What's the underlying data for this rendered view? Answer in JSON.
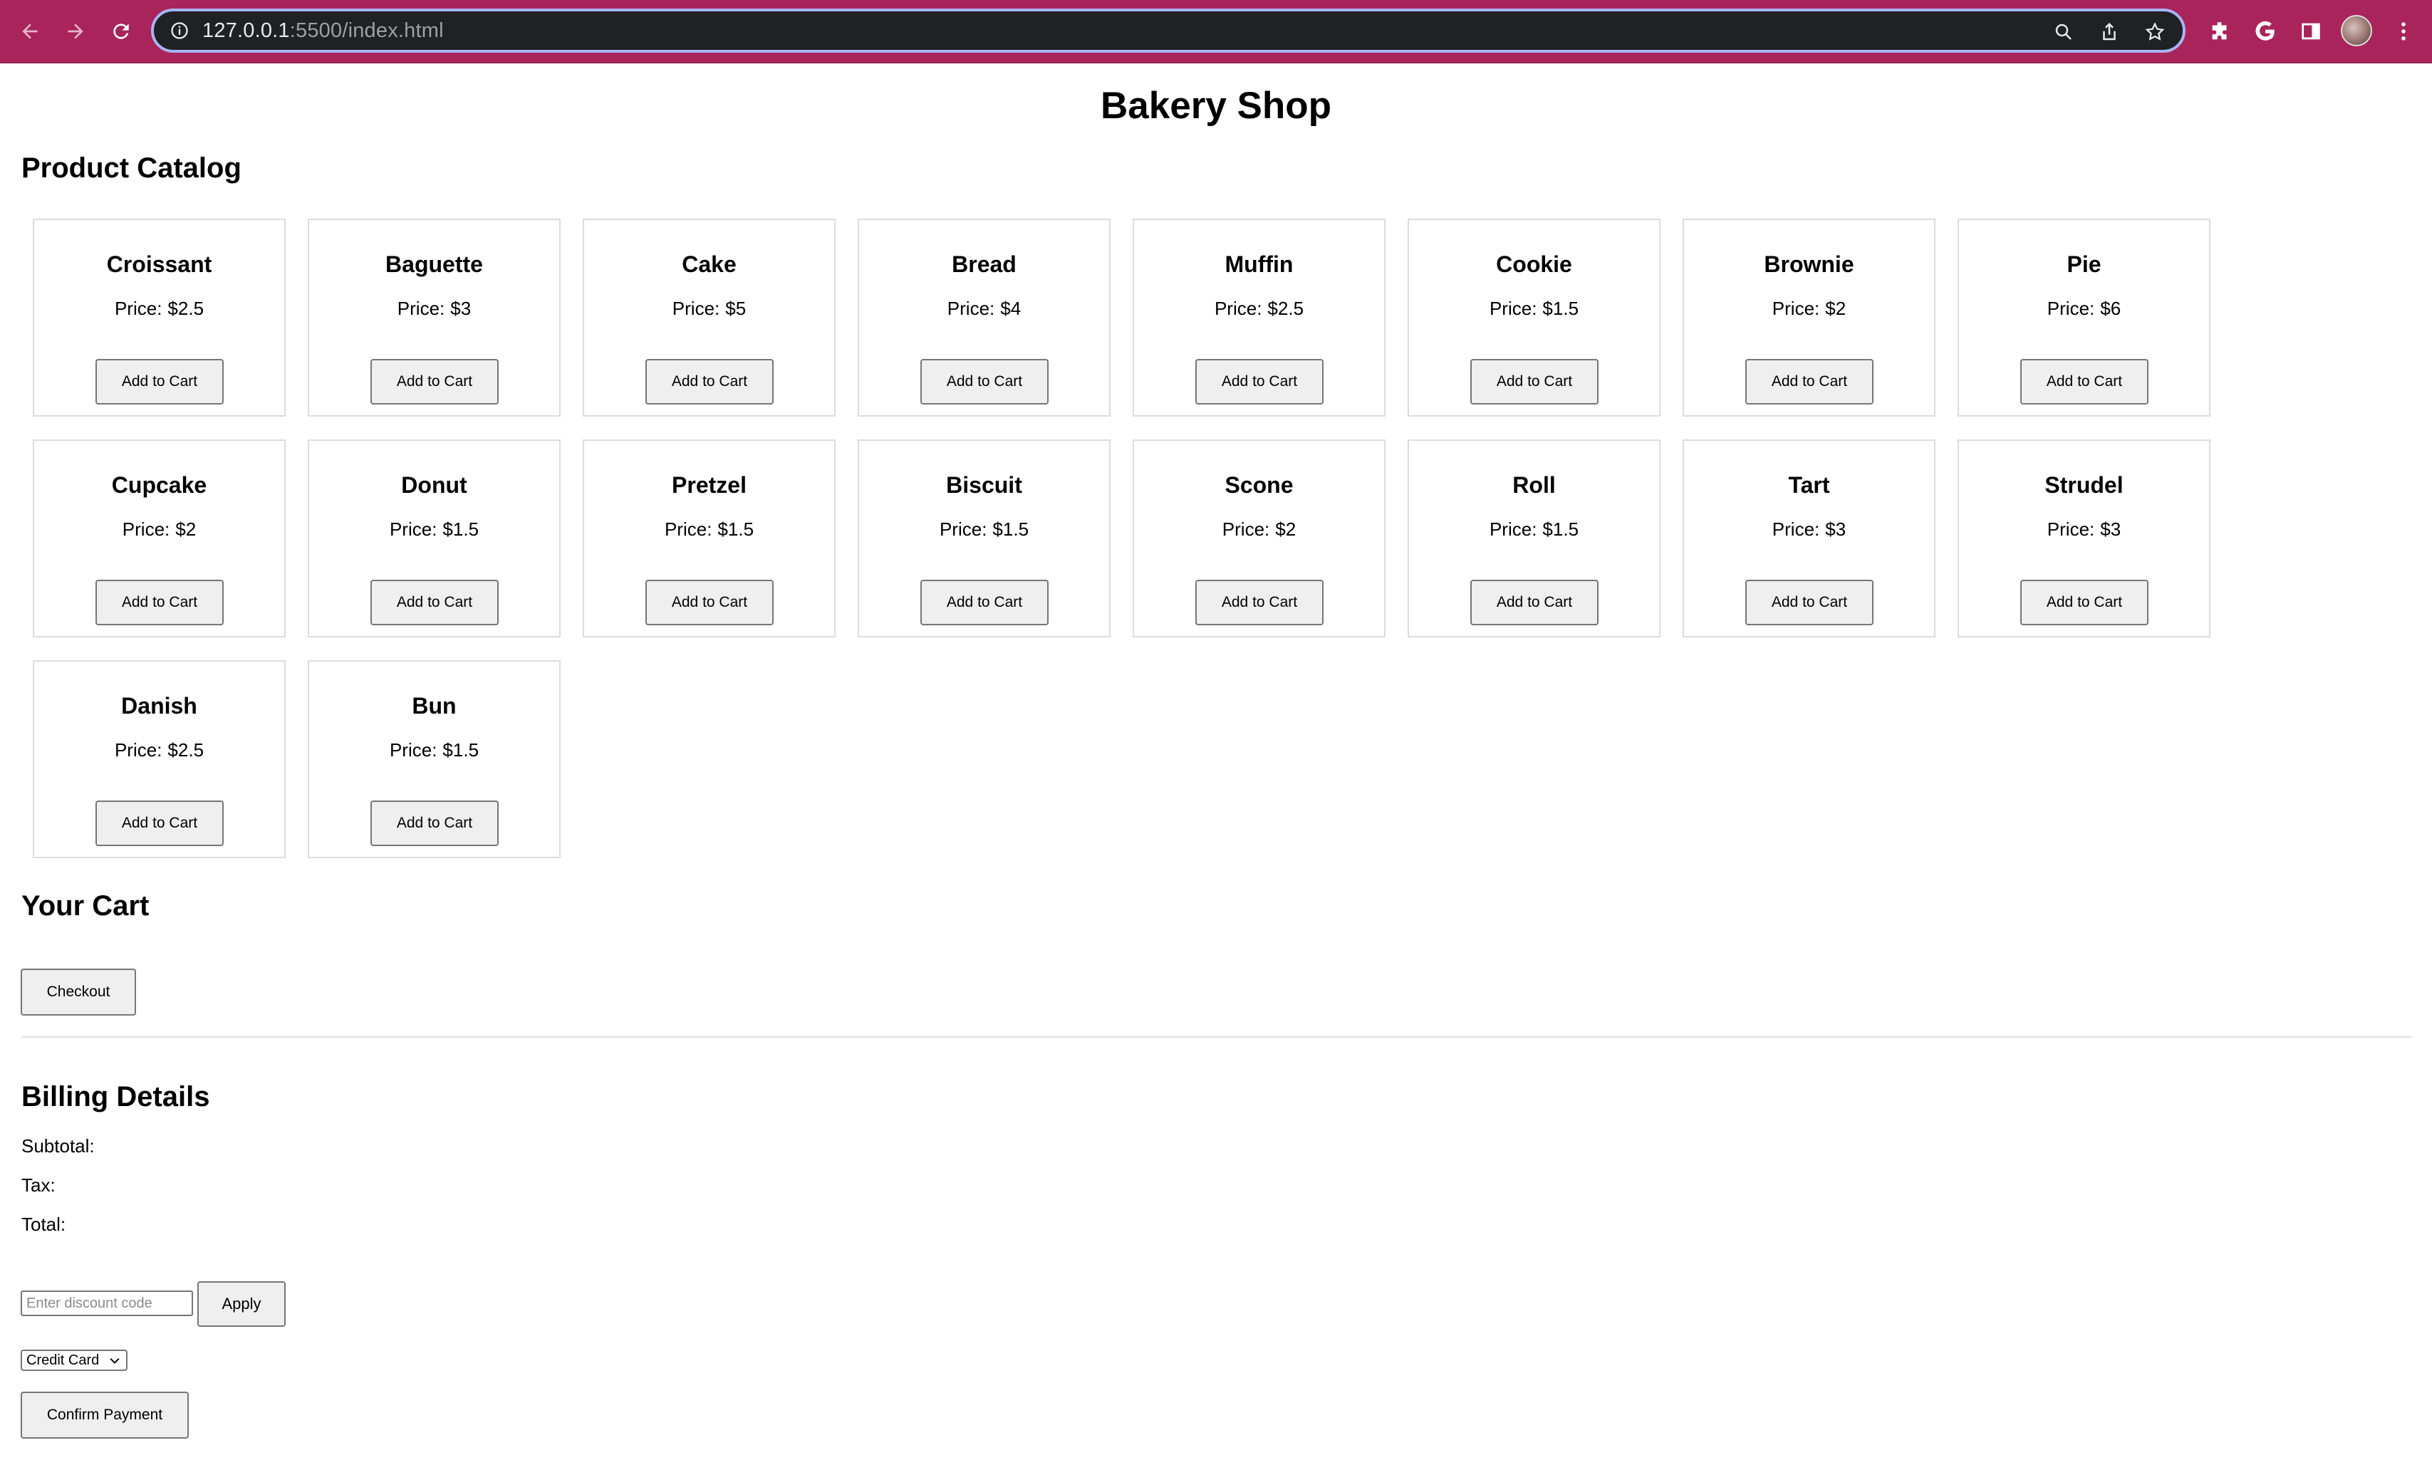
{
  "browser": {
    "url_host": "127.0.0.1",
    "url_rest": ":5500/index.html"
  },
  "page": {
    "title": "Bakery Shop",
    "catalog_heading": "Product Catalog",
    "cart_heading": "Your Cart",
    "checkout_label": "Checkout",
    "billing_heading": "Billing Details",
    "subtotal_label": "Subtotal:",
    "tax_label": "Tax:",
    "total_label": "Total:",
    "discount_placeholder": "Enter discount code",
    "apply_label": "Apply",
    "payment_method": "Credit Card",
    "confirm_label": "Confirm Payment"
  },
  "products": [
    {
      "name": "Croissant",
      "price_label": "Price:",
      "price": "$2.5",
      "button": "Add to Cart"
    },
    {
      "name": "Baguette",
      "price_label": "Price:",
      "price": "$3",
      "button": "Add to Cart"
    },
    {
      "name": "Cake",
      "price_label": "Price:",
      "price": "$5",
      "button": "Add to Cart"
    },
    {
      "name": "Bread",
      "price_label": "Price:",
      "price": "$4",
      "button": "Add to Cart"
    },
    {
      "name": "Muffin",
      "price_label": "Price:",
      "price": "$2.5",
      "button": "Add to Cart"
    },
    {
      "name": "Cookie",
      "price_label": "Price:",
      "price": "$1.5",
      "button": "Add to Cart"
    },
    {
      "name": "Brownie",
      "price_label": "Price:",
      "price": "$2",
      "button": "Add to Cart"
    },
    {
      "name": "Pie",
      "price_label": "Price:",
      "price": "$6",
      "button": "Add to Cart"
    },
    {
      "name": "Cupcake",
      "price_label": "Price:",
      "price": "$2",
      "button": "Add to Cart"
    },
    {
      "name": "Donut",
      "price_label": "Price:",
      "price": "$1.5",
      "button": "Add to Cart"
    },
    {
      "name": "Pretzel",
      "price_label": "Price:",
      "price": "$1.5",
      "button": "Add to Cart"
    },
    {
      "name": "Biscuit",
      "price_label": "Price:",
      "price": "$1.5",
      "button": "Add to Cart"
    },
    {
      "name": "Scone",
      "price_label": "Price:",
      "price": "$2",
      "button": "Add to Cart"
    },
    {
      "name": "Roll",
      "price_label": "Price:",
      "price": "$1.5",
      "button": "Add to Cart"
    },
    {
      "name": "Tart",
      "price_label": "Price:",
      "price": "$3",
      "button": "Add to Cart"
    },
    {
      "name": "Strudel",
      "price_label": "Price:",
      "price": "$3",
      "button": "Add to Cart"
    },
    {
      "name": "Danish",
      "price_label": "Price:",
      "price": "$2.5",
      "button": "Add to Cart"
    },
    {
      "name": "Bun",
      "price_label": "Price:",
      "price": "$1.5",
      "button": "Add to Cart"
    }
  ],
  "colors": {
    "chrome_frame": "#a8245a",
    "omnibox_bg": "#202124",
    "omnibox_focus_ring": "#a7b5f2"
  },
  "icons": {
    "back": "back-arrow-icon",
    "forward": "forward-arrow-icon",
    "reload": "reload-icon",
    "site_info": "info-icon",
    "zoom": "magnifier-icon",
    "share": "share-icon",
    "bookmark": "star-icon",
    "extensions": "puzzle-icon",
    "google": "google-g-icon",
    "side_panel": "side-panel-icon",
    "menu": "kebab-menu-icon"
  }
}
